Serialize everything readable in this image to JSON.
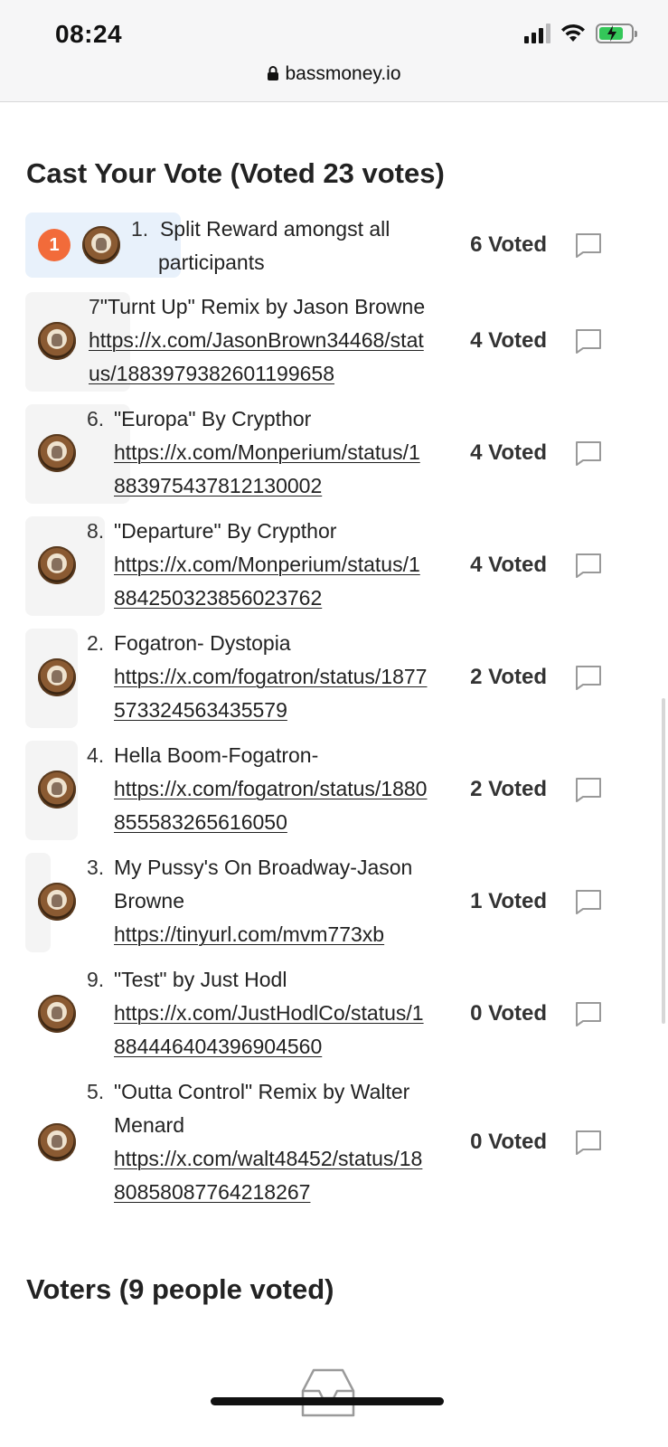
{
  "status_bar": {
    "time": "08:24"
  },
  "browser": {
    "url": "bassmoney.io"
  },
  "vote_section": {
    "title": "Cast Your Vote (Voted 23 votes)",
    "options": [
      {
        "rank_badge": "1",
        "number": "1.",
        "lines": [
          "Split Reward amongst all",
          "participants"
        ],
        "link_lines": [],
        "votes": "6 Voted"
      },
      {
        "number": "7",
        "lines": [
          "\"Turnt Up\" Remix by Jason Browne"
        ],
        "link_lines": [
          "https://x.com/JasonBrown34468/stat",
          "us/1883979382601199658"
        ],
        "votes": "4 Voted"
      },
      {
        "number": "6.",
        "lines": [
          "\"Europa\" By Crypthor"
        ],
        "link_lines": [
          "https://x.com/Monperium/status/1",
          "883975437812130002"
        ],
        "votes": "4 Voted"
      },
      {
        "number": "8.",
        "lines": [
          "\"Departure\" By Crypthor"
        ],
        "link_lines": [
          "https://x.com/Monperium/status/1",
          "884250323856023762"
        ],
        "votes": "4 Voted"
      },
      {
        "number": "2.",
        "lines": [
          "Fogatron- Dystopia"
        ],
        "link_lines": [
          "https://x.com/fogatron/status/1877",
          "573324563435579"
        ],
        "votes": "2 Voted"
      },
      {
        "number": "4.",
        "lines": [
          "Hella Boom-Fogatron-"
        ],
        "link_lines": [
          "https://x.com/fogatron/status/1880",
          "855583265616050"
        ],
        "votes": "2 Voted"
      },
      {
        "number": "3.",
        "lines": [
          "My Pussy's On Broadway-Jason",
          "Browne"
        ],
        "link_lines": [
          "https://tinyurl.com/mvm773xb"
        ],
        "votes": "1 Voted"
      },
      {
        "number": "9.",
        "lines": [
          "\"Test\" by Just Hodl"
        ],
        "link_lines": [
          "https://x.com/JustHodlCo/status/1",
          "884446404396904560"
        ],
        "votes": "0 Voted"
      },
      {
        "number": "5.",
        "lines": [
          "\"Outta Control\" Remix by Walter",
          "Menard"
        ],
        "link_lines": [
          "https://x.com/walt48452/status/18",
          "80858087764218267"
        ],
        "votes": "0 Voted"
      }
    ]
  },
  "voters_section": {
    "title": "Voters (9 people voted)"
  },
  "icons": {
    "comment": "comment-bubble-icon",
    "lock": "lock-icon",
    "tray": "inbox-tray-icon"
  },
  "colors": {
    "badge": "#f26b3a",
    "highlight_first": "#e8f1fb",
    "battery_fill": "#34c759"
  }
}
